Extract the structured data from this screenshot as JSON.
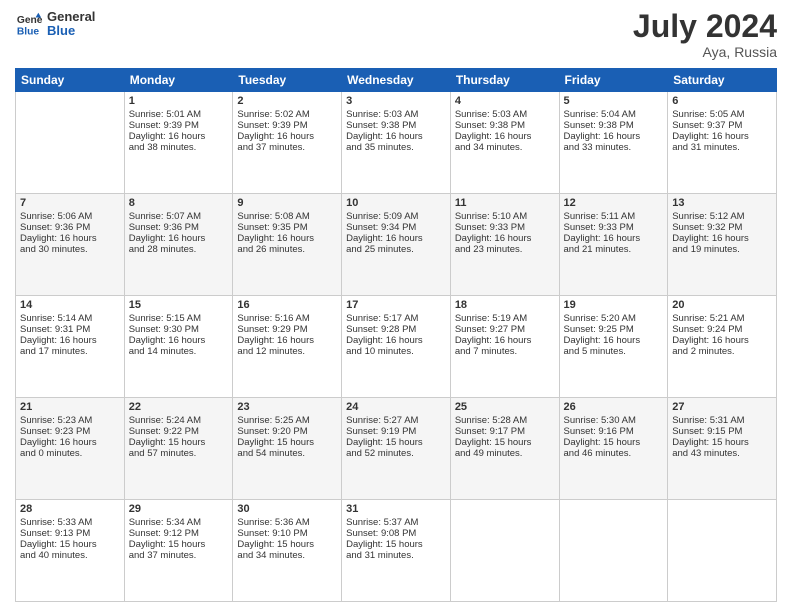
{
  "header": {
    "logo_general": "General",
    "logo_blue": "Blue",
    "month_title": "July 2024",
    "location": "Aya, Russia"
  },
  "days_of_week": [
    "Sunday",
    "Monday",
    "Tuesday",
    "Wednesday",
    "Thursday",
    "Friday",
    "Saturday"
  ],
  "weeks": [
    [
      {
        "day": "",
        "info": ""
      },
      {
        "day": "1",
        "info": "Sunrise: 5:01 AM\nSunset: 9:39 PM\nDaylight: 16 hours\nand 38 minutes."
      },
      {
        "day": "2",
        "info": "Sunrise: 5:02 AM\nSunset: 9:39 PM\nDaylight: 16 hours\nand 37 minutes."
      },
      {
        "day": "3",
        "info": "Sunrise: 5:03 AM\nSunset: 9:38 PM\nDaylight: 16 hours\nand 35 minutes."
      },
      {
        "day": "4",
        "info": "Sunrise: 5:03 AM\nSunset: 9:38 PM\nDaylight: 16 hours\nand 34 minutes."
      },
      {
        "day": "5",
        "info": "Sunrise: 5:04 AM\nSunset: 9:38 PM\nDaylight: 16 hours\nand 33 minutes."
      },
      {
        "day": "6",
        "info": "Sunrise: 5:05 AM\nSunset: 9:37 PM\nDaylight: 16 hours\nand 31 minutes."
      }
    ],
    [
      {
        "day": "7",
        "info": "Sunrise: 5:06 AM\nSunset: 9:36 PM\nDaylight: 16 hours\nand 30 minutes."
      },
      {
        "day": "8",
        "info": "Sunrise: 5:07 AM\nSunset: 9:36 PM\nDaylight: 16 hours\nand 28 minutes."
      },
      {
        "day": "9",
        "info": "Sunrise: 5:08 AM\nSunset: 9:35 PM\nDaylight: 16 hours\nand 26 minutes."
      },
      {
        "day": "10",
        "info": "Sunrise: 5:09 AM\nSunset: 9:34 PM\nDaylight: 16 hours\nand 25 minutes."
      },
      {
        "day": "11",
        "info": "Sunrise: 5:10 AM\nSunset: 9:33 PM\nDaylight: 16 hours\nand 23 minutes."
      },
      {
        "day": "12",
        "info": "Sunrise: 5:11 AM\nSunset: 9:33 PM\nDaylight: 16 hours\nand 21 minutes."
      },
      {
        "day": "13",
        "info": "Sunrise: 5:12 AM\nSunset: 9:32 PM\nDaylight: 16 hours\nand 19 minutes."
      }
    ],
    [
      {
        "day": "14",
        "info": "Sunrise: 5:14 AM\nSunset: 9:31 PM\nDaylight: 16 hours\nand 17 minutes."
      },
      {
        "day": "15",
        "info": "Sunrise: 5:15 AM\nSunset: 9:30 PM\nDaylight: 16 hours\nand 14 minutes."
      },
      {
        "day": "16",
        "info": "Sunrise: 5:16 AM\nSunset: 9:29 PM\nDaylight: 16 hours\nand 12 minutes."
      },
      {
        "day": "17",
        "info": "Sunrise: 5:17 AM\nSunset: 9:28 PM\nDaylight: 16 hours\nand 10 minutes."
      },
      {
        "day": "18",
        "info": "Sunrise: 5:19 AM\nSunset: 9:27 PM\nDaylight: 16 hours\nand 7 minutes."
      },
      {
        "day": "19",
        "info": "Sunrise: 5:20 AM\nSunset: 9:25 PM\nDaylight: 16 hours\nand 5 minutes."
      },
      {
        "day": "20",
        "info": "Sunrise: 5:21 AM\nSunset: 9:24 PM\nDaylight: 16 hours\nand 2 minutes."
      }
    ],
    [
      {
        "day": "21",
        "info": "Sunrise: 5:23 AM\nSunset: 9:23 PM\nDaylight: 16 hours\nand 0 minutes."
      },
      {
        "day": "22",
        "info": "Sunrise: 5:24 AM\nSunset: 9:22 PM\nDaylight: 15 hours\nand 57 minutes."
      },
      {
        "day": "23",
        "info": "Sunrise: 5:25 AM\nSunset: 9:20 PM\nDaylight: 15 hours\nand 54 minutes."
      },
      {
        "day": "24",
        "info": "Sunrise: 5:27 AM\nSunset: 9:19 PM\nDaylight: 15 hours\nand 52 minutes."
      },
      {
        "day": "25",
        "info": "Sunrise: 5:28 AM\nSunset: 9:17 PM\nDaylight: 15 hours\nand 49 minutes."
      },
      {
        "day": "26",
        "info": "Sunrise: 5:30 AM\nSunset: 9:16 PM\nDaylight: 15 hours\nand 46 minutes."
      },
      {
        "day": "27",
        "info": "Sunrise: 5:31 AM\nSunset: 9:15 PM\nDaylight: 15 hours\nand 43 minutes."
      }
    ],
    [
      {
        "day": "28",
        "info": "Sunrise: 5:33 AM\nSunset: 9:13 PM\nDaylight: 15 hours\nand 40 minutes."
      },
      {
        "day": "29",
        "info": "Sunrise: 5:34 AM\nSunset: 9:12 PM\nDaylight: 15 hours\nand 37 minutes."
      },
      {
        "day": "30",
        "info": "Sunrise: 5:36 AM\nSunset: 9:10 PM\nDaylight: 15 hours\nand 34 minutes."
      },
      {
        "day": "31",
        "info": "Sunrise: 5:37 AM\nSunset: 9:08 PM\nDaylight: 15 hours\nand 31 minutes."
      },
      {
        "day": "",
        "info": ""
      },
      {
        "day": "",
        "info": ""
      },
      {
        "day": "",
        "info": ""
      }
    ]
  ]
}
